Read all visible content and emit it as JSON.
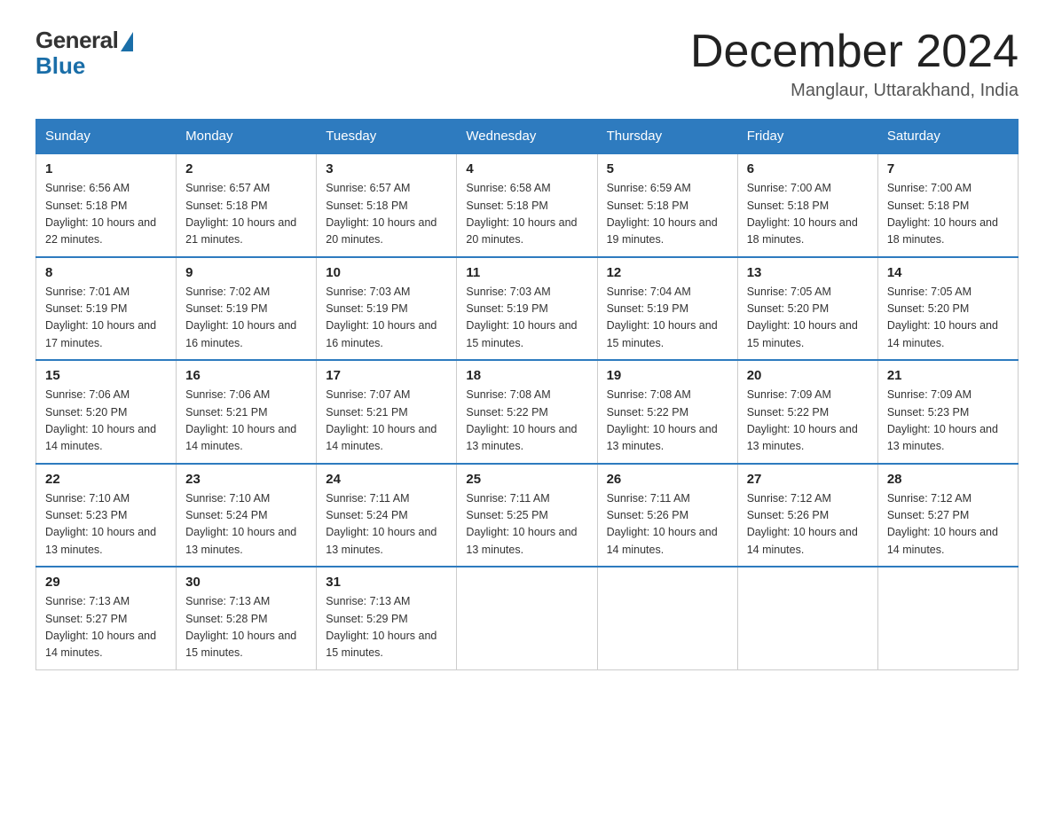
{
  "logo": {
    "general": "General",
    "blue": "Blue"
  },
  "title": "December 2024",
  "location": "Manglaur, Uttarakhand, India",
  "headers": [
    "Sunday",
    "Monday",
    "Tuesday",
    "Wednesday",
    "Thursday",
    "Friday",
    "Saturday"
  ],
  "weeks": [
    [
      {
        "day": "1",
        "sunrise": "6:56 AM",
        "sunset": "5:18 PM",
        "daylight": "10 hours and 22 minutes."
      },
      {
        "day": "2",
        "sunrise": "6:57 AM",
        "sunset": "5:18 PM",
        "daylight": "10 hours and 21 minutes."
      },
      {
        "day": "3",
        "sunrise": "6:57 AM",
        "sunset": "5:18 PM",
        "daylight": "10 hours and 20 minutes."
      },
      {
        "day": "4",
        "sunrise": "6:58 AM",
        "sunset": "5:18 PM",
        "daylight": "10 hours and 20 minutes."
      },
      {
        "day": "5",
        "sunrise": "6:59 AM",
        "sunset": "5:18 PM",
        "daylight": "10 hours and 19 minutes."
      },
      {
        "day": "6",
        "sunrise": "7:00 AM",
        "sunset": "5:18 PM",
        "daylight": "10 hours and 18 minutes."
      },
      {
        "day": "7",
        "sunrise": "7:00 AM",
        "sunset": "5:18 PM",
        "daylight": "10 hours and 18 minutes."
      }
    ],
    [
      {
        "day": "8",
        "sunrise": "7:01 AM",
        "sunset": "5:19 PM",
        "daylight": "10 hours and 17 minutes."
      },
      {
        "day": "9",
        "sunrise": "7:02 AM",
        "sunset": "5:19 PM",
        "daylight": "10 hours and 16 minutes."
      },
      {
        "day": "10",
        "sunrise": "7:03 AM",
        "sunset": "5:19 PM",
        "daylight": "10 hours and 16 minutes."
      },
      {
        "day": "11",
        "sunrise": "7:03 AM",
        "sunset": "5:19 PM",
        "daylight": "10 hours and 15 minutes."
      },
      {
        "day": "12",
        "sunrise": "7:04 AM",
        "sunset": "5:19 PM",
        "daylight": "10 hours and 15 minutes."
      },
      {
        "day": "13",
        "sunrise": "7:05 AM",
        "sunset": "5:20 PM",
        "daylight": "10 hours and 15 minutes."
      },
      {
        "day": "14",
        "sunrise": "7:05 AM",
        "sunset": "5:20 PM",
        "daylight": "10 hours and 14 minutes."
      }
    ],
    [
      {
        "day": "15",
        "sunrise": "7:06 AM",
        "sunset": "5:20 PM",
        "daylight": "10 hours and 14 minutes."
      },
      {
        "day": "16",
        "sunrise": "7:06 AM",
        "sunset": "5:21 PM",
        "daylight": "10 hours and 14 minutes."
      },
      {
        "day": "17",
        "sunrise": "7:07 AM",
        "sunset": "5:21 PM",
        "daylight": "10 hours and 14 minutes."
      },
      {
        "day": "18",
        "sunrise": "7:08 AM",
        "sunset": "5:22 PM",
        "daylight": "10 hours and 13 minutes."
      },
      {
        "day": "19",
        "sunrise": "7:08 AM",
        "sunset": "5:22 PM",
        "daylight": "10 hours and 13 minutes."
      },
      {
        "day": "20",
        "sunrise": "7:09 AM",
        "sunset": "5:22 PM",
        "daylight": "10 hours and 13 minutes."
      },
      {
        "day": "21",
        "sunrise": "7:09 AM",
        "sunset": "5:23 PM",
        "daylight": "10 hours and 13 minutes."
      }
    ],
    [
      {
        "day": "22",
        "sunrise": "7:10 AM",
        "sunset": "5:23 PM",
        "daylight": "10 hours and 13 minutes."
      },
      {
        "day": "23",
        "sunrise": "7:10 AM",
        "sunset": "5:24 PM",
        "daylight": "10 hours and 13 minutes."
      },
      {
        "day": "24",
        "sunrise": "7:11 AM",
        "sunset": "5:24 PM",
        "daylight": "10 hours and 13 minutes."
      },
      {
        "day": "25",
        "sunrise": "7:11 AM",
        "sunset": "5:25 PM",
        "daylight": "10 hours and 13 minutes."
      },
      {
        "day": "26",
        "sunrise": "7:11 AM",
        "sunset": "5:26 PM",
        "daylight": "10 hours and 14 minutes."
      },
      {
        "day": "27",
        "sunrise": "7:12 AM",
        "sunset": "5:26 PM",
        "daylight": "10 hours and 14 minutes."
      },
      {
        "day": "28",
        "sunrise": "7:12 AM",
        "sunset": "5:27 PM",
        "daylight": "10 hours and 14 minutes."
      }
    ],
    [
      {
        "day": "29",
        "sunrise": "7:13 AM",
        "sunset": "5:27 PM",
        "daylight": "10 hours and 14 minutes."
      },
      {
        "day": "30",
        "sunrise": "7:13 AM",
        "sunset": "5:28 PM",
        "daylight": "10 hours and 15 minutes."
      },
      {
        "day": "31",
        "sunrise": "7:13 AM",
        "sunset": "5:29 PM",
        "daylight": "10 hours and 15 minutes."
      },
      null,
      null,
      null,
      null
    ]
  ]
}
